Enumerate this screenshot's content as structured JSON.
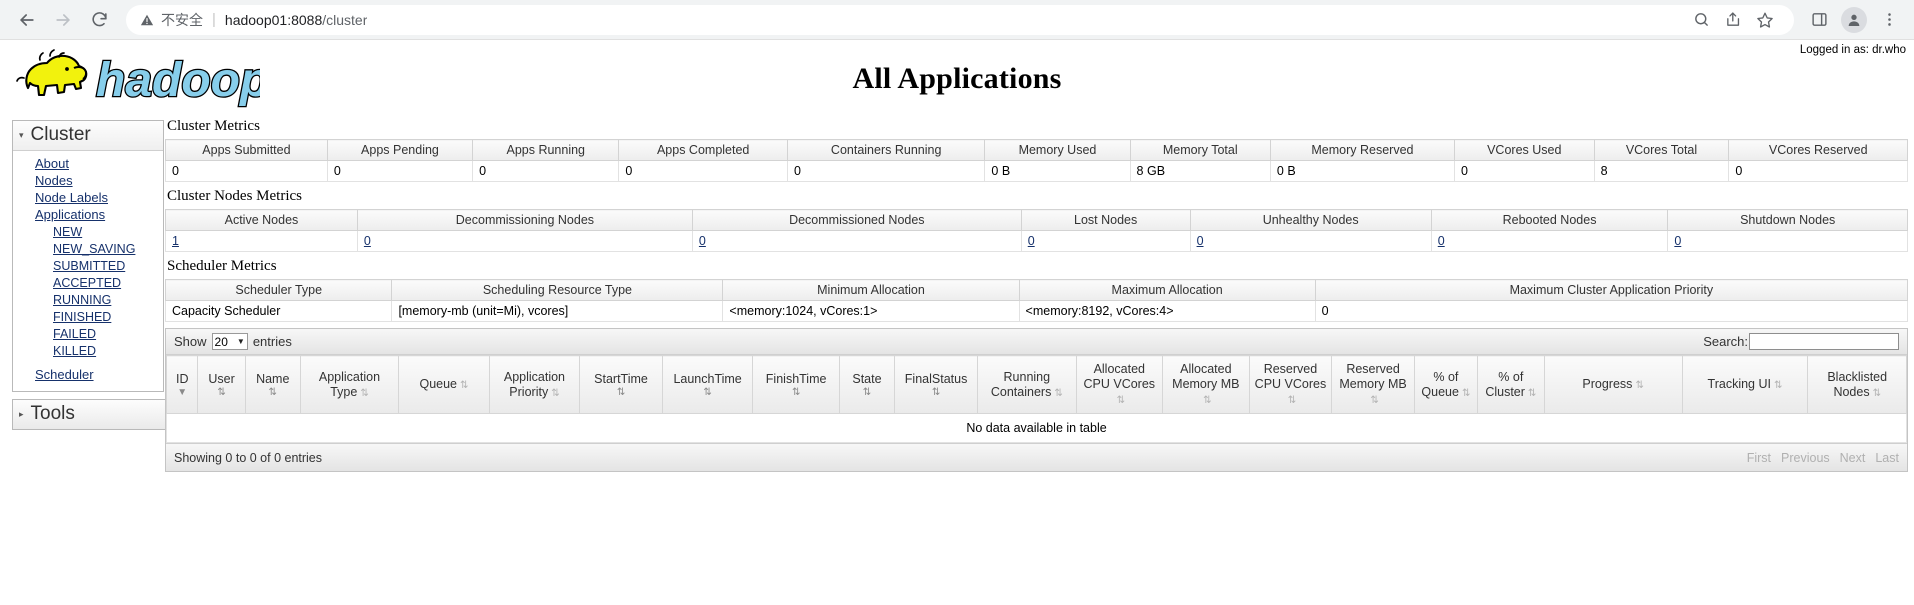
{
  "browser": {
    "back_icon": "arrow-left-icon",
    "forward_icon": "arrow-right-icon",
    "reload_icon": "reload-icon",
    "warning_icon": "warning-triangle-icon",
    "security_label": "不安全",
    "url_host": "hadoop01:8088",
    "url_path": "/cluster",
    "search_icon": "search-icon",
    "share_icon": "share-icon",
    "bookmark_icon": "star-icon",
    "sidepanel_icon": "side-panel-icon",
    "profile_icon": "profile-avatar-icon",
    "menu_icon": "three-dot-menu-icon"
  },
  "header": {
    "logo_text": "hadoop",
    "title": "All Applications",
    "logged_in": "Logged in as: dr.who"
  },
  "sidebar": {
    "cluster": {
      "label": "Cluster",
      "caret": "▾",
      "links": [
        {
          "label": "About"
        },
        {
          "label": "Nodes"
        },
        {
          "label": "Node Labels"
        },
        {
          "label": "Applications"
        }
      ],
      "app_states": [
        {
          "label": "NEW"
        },
        {
          "label": "NEW_SAVING"
        },
        {
          "label": "SUBMITTED"
        },
        {
          "label": "ACCEPTED"
        },
        {
          "label": "RUNNING"
        },
        {
          "label": "FINISHED"
        },
        {
          "label": "FAILED"
        },
        {
          "label": "KILLED"
        }
      ],
      "scheduler": {
        "label": "Scheduler"
      }
    },
    "tools": {
      "label": "Tools",
      "caret": "▸"
    }
  },
  "cluster_metrics": {
    "title": "Cluster Metrics",
    "headers": [
      "Apps Submitted",
      "Apps Pending",
      "Apps Running",
      "Apps Completed",
      "Containers Running",
      "Memory Used",
      "Memory Total",
      "Memory Reserved",
      "VCores Used",
      "VCores Total",
      "VCores Reserved"
    ],
    "values": [
      "0",
      "0",
      "0",
      "0",
      "0",
      "0 B",
      "8 GB",
      "0 B",
      "0",
      "8",
      "0"
    ]
  },
  "cluster_nodes_metrics": {
    "title": "Cluster Nodes Metrics",
    "headers": [
      "Active Nodes",
      "Decommissioning Nodes",
      "Decommissioned Nodes",
      "Lost Nodes",
      "Unhealthy Nodes",
      "Rebooted Nodes",
      "Shutdown Nodes"
    ],
    "values": [
      "1",
      "0",
      "0",
      "0",
      "0",
      "0",
      "0"
    ]
  },
  "scheduler_metrics": {
    "title": "Scheduler Metrics",
    "headers": [
      "Scheduler Type",
      "Scheduling Resource Type",
      "Minimum Allocation",
      "Maximum Allocation",
      "Maximum Cluster Application Priority"
    ],
    "values": [
      "Capacity Scheduler",
      "[memory-mb (unit=Mi), vcores]",
      "<memory:1024, vCores:1>",
      "<memory:8192, vCores:4>",
      "0"
    ]
  },
  "apps_table": {
    "show_label": "Show",
    "entries_label": "entries",
    "page_length": "20",
    "search_label": "Search:",
    "search_value": "",
    "search_placeholder": "",
    "columns": [
      {
        "label": "ID",
        "sort": "desc"
      },
      {
        "label": "User",
        "sort": "both"
      },
      {
        "label": "Name",
        "sort": "both"
      },
      {
        "label": "Application Type",
        "sort": "both"
      },
      {
        "label": "Queue",
        "sort": "both"
      },
      {
        "label": "Application Priority",
        "sort": "both"
      },
      {
        "label": "StartTime",
        "sort": "both"
      },
      {
        "label": "LaunchTime",
        "sort": "both"
      },
      {
        "label": "FinishTime",
        "sort": "both"
      },
      {
        "label": "State",
        "sort": "both"
      },
      {
        "label": "FinalStatus",
        "sort": "both"
      },
      {
        "label": "Running Containers",
        "sort": "both"
      },
      {
        "label": "Allocated CPU VCores",
        "sort": "both"
      },
      {
        "label": "Allocated Memory MB",
        "sort": "both"
      },
      {
        "label": "Reserved CPU VCores",
        "sort": "both"
      },
      {
        "label": "Reserved Memory MB",
        "sort": "both"
      },
      {
        "label": "% of Queue",
        "sort": "both"
      },
      {
        "label": "% of Cluster",
        "sort": "both"
      },
      {
        "label": "Progress",
        "sort": "both"
      },
      {
        "label": "Tracking UI",
        "sort": "both"
      },
      {
        "label": "Blacklisted Nodes",
        "sort": "both"
      }
    ],
    "empty_text": "No data available in table",
    "info_text": "Showing 0 to 0 of 0 entries",
    "pagination": [
      {
        "label": "First"
      },
      {
        "label": "Previous"
      },
      {
        "label": "Next"
      },
      {
        "label": "Last"
      }
    ]
  },
  "colors": {
    "link": "#16316b",
    "logo_text": "#87ceeb",
    "logo_body": "#f2f20d"
  }
}
